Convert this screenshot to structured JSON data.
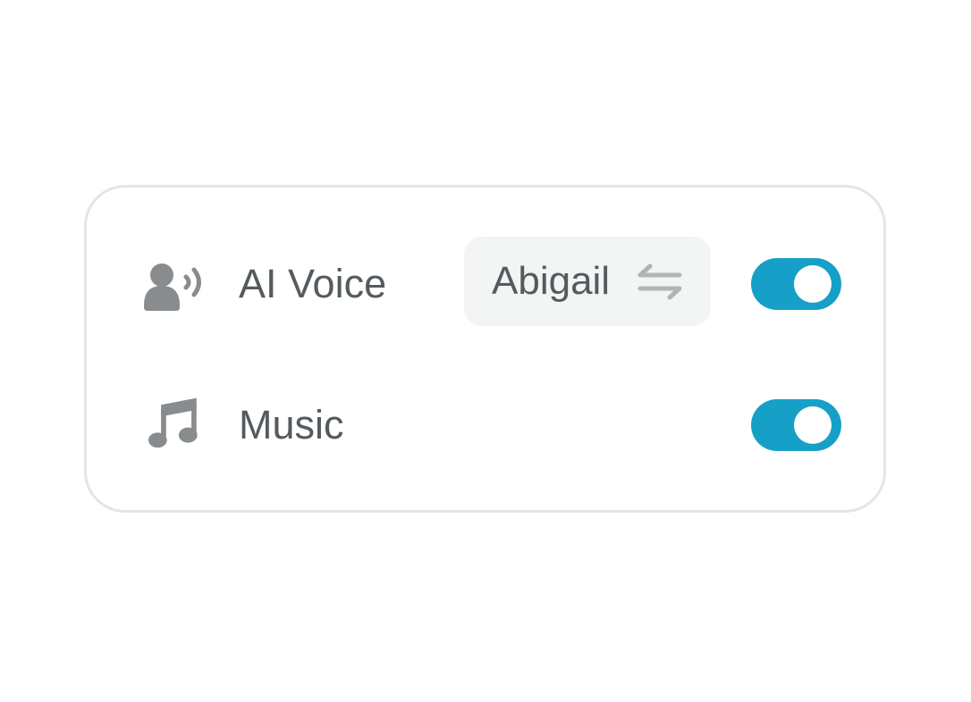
{
  "settings": {
    "rows": [
      {
        "label": "AI Voice",
        "icon": "voice-person-icon",
        "selected_voice": "Abigail",
        "action_icon": "swap-arrows-icon",
        "enabled": true
      },
      {
        "label": "Music",
        "icon": "music-note-icon",
        "enabled": true
      }
    ]
  },
  "colors": {
    "toggle_on": "#16a0c8",
    "icon": "#888c8e",
    "text": "#545b5e",
    "chip_bg": "#f3f4f4",
    "card_border": "#e3e5e6",
    "swap_icon": "#b2b5b6"
  }
}
